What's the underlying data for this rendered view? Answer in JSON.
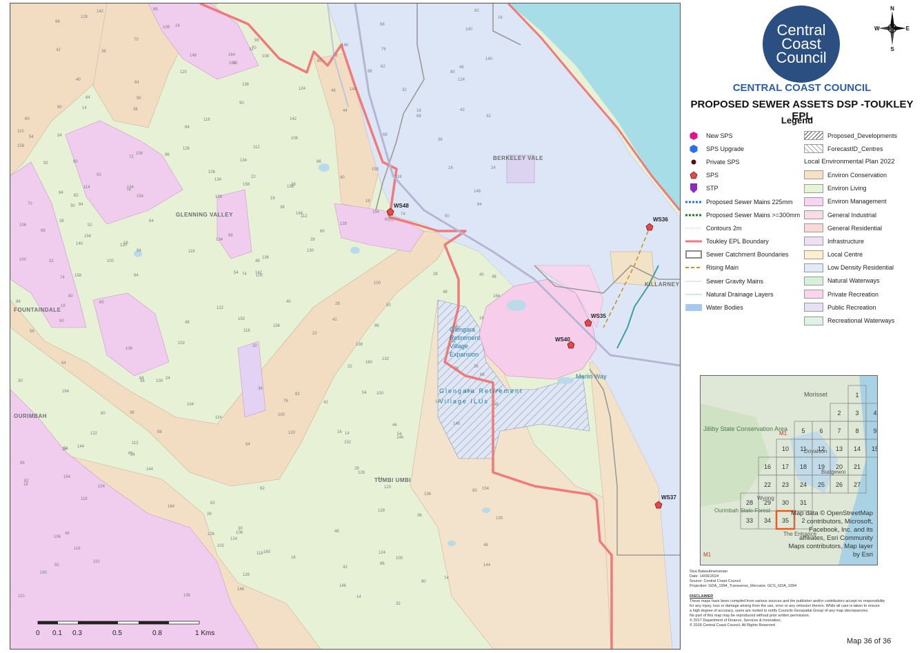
{
  "map": {
    "place_labels": [
      "BERKELEY VALE",
      "GLENNING VALLEY",
      "FOUNTAINDALE",
      "OURIMBAH",
      "TUMBI UMBI",
      "KILLARNEY VALE"
    ],
    "captions": {
      "glengara_expansion": [
        "Glengara",
        "Retirement",
        "Village",
        "Expansion"
      ],
      "glengara_ilus": [
        "Glengara Retirement",
        "Village ILUs"
      ],
      "small_area": "Marlin Way"
    },
    "sps_points": [
      {
        "label": "WS48"
      },
      {
        "label": "WS36"
      },
      {
        "label": "WS35"
      },
      {
        "label": "WS40"
      },
      {
        "label": "WS37"
      }
    ],
    "contour_values": [
      "14",
      "16",
      "18",
      "22",
      "24",
      "26",
      "28",
      "30",
      "32",
      "34",
      "36",
      "38",
      "40",
      "42",
      "44",
      "46",
      "48",
      "50",
      "52",
      "54",
      "56",
      "60",
      "62",
      "64",
      "68",
      "70",
      "72",
      "74",
      "76",
      "80",
      "82",
      "84",
      "86",
      "88",
      "90",
      "92",
      "94",
      "96",
      "98",
      "100",
      "102",
      "104",
      "106",
      "108",
      "110",
      "112",
      "114",
      "116",
      "118",
      "120",
      "122",
      "124",
      "126",
      "128",
      "130",
      "132",
      "134",
      "136",
      "138",
      "140",
      "142",
      "144",
      "146",
      "148",
      "150",
      "152",
      "154",
      "156",
      "158",
      "160",
      "164",
      "166"
    ],
    "scale_bar": {
      "ticks": [
        "0",
        "0.1",
        "0.3",
        "0.5",
        "0.8",
        "1 Kms"
      ]
    },
    "colors": {
      "environ_conservation": "#f3dcc0",
      "environ_living": "#e4f2d2",
      "environ_management": "#f2cdee",
      "low_density_residential": "#dce6f5",
      "private_recreation": "#f7cde8",
      "public_recreation": "#ddd4f0",
      "water": "#a9dce6",
      "epl_boundary": "#f07a7a"
    }
  },
  "sidebar": {
    "logo_lines": [
      "Central",
      "Coast",
      "Council"
    ],
    "compass": {
      "n": "N",
      "s": "S",
      "e": "E",
      "w": "W"
    },
    "org_name": "CENTRAL COAST COUNCIL",
    "map_title": "PROPOSED SEWER ASSETS DSP -TOUKLEY EPL",
    "legend_title": "Legend",
    "legend_left": [
      {
        "label": "New SPS",
        "icon": "hexagon-magenta"
      },
      {
        "label": "SPS Upgrade",
        "icon": "hexagon-blue"
      },
      {
        "label": "Private SPS",
        "icon": "dot-dark-red"
      },
      {
        "label": "SPS",
        "icon": "pentagon-red"
      },
      {
        "label": "STP",
        "icon": "pin-purple"
      },
      {
        "label": "Proposed Sewer Mains 225mm",
        "icon": "dashed-blue"
      },
      {
        "label": "Proposed Sewer Mains >=300mm",
        "icon": "dashed-green"
      },
      {
        "label": "Contours 2m",
        "icon": "dotted-grey"
      },
      {
        "label": "Toukley EPL Boundary",
        "icon": "line-red"
      },
      {
        "label": "Sewer Catchment Boundaries",
        "icon": "box-grey"
      },
      {
        "label": "Rising Main",
        "icon": "dashed-orange"
      },
      {
        "label": "Sewer Gravity Mains",
        "icon": "line-thin-grey"
      },
      {
        "label": "Natural Drainage Layers",
        "icon": "line-thin-blue"
      },
      {
        "label": "Water Bodies",
        "icon": "box-water"
      }
    ],
    "legend_right_top": [
      {
        "label": "Proposed_Developments",
        "icon": "hatch-dense"
      },
      {
        "label": "ForecastID_Centres",
        "icon": "hatch-sparse"
      }
    ],
    "lep_heading": "Local Environmental Plan 2022",
    "lep_zones": [
      {
        "label": "Environ Conservation",
        "color": "#f6e1c6"
      },
      {
        "label": "Environ Living",
        "color": "#e6f4d6"
      },
      {
        "label": "Environ Management",
        "color": "#f6d4f2"
      },
      {
        "label": "General Industrial",
        "color": "#f7dce8"
      },
      {
        "label": "General Residential",
        "color": "#fbd8d8"
      },
      {
        "label": "Infrastructure",
        "color": "#ede0f4"
      },
      {
        "label": "Local Centre",
        "color": "#fbefcf"
      },
      {
        "label": "Low Density Residential",
        "color": "#e1eaf7"
      },
      {
        "label": "Natural Waterways",
        "color": "#d6f0da"
      },
      {
        "label": "Private Recreation",
        "color": "#f9d6ec"
      },
      {
        "label": "Public Recreation",
        "color": "#e6e0f5"
      },
      {
        "label": "Recreational Waterways",
        "color": "#ddf3e3"
      }
    ],
    "inset": {
      "grid_numbers": [
        "1",
        "2",
        "3",
        "4",
        "5",
        "6",
        "7",
        "8",
        "9",
        "10",
        "11",
        "12",
        "13",
        "14",
        "15",
        "16",
        "17",
        "18",
        "19",
        "20",
        "21",
        "22",
        "23",
        "24",
        "25",
        "26",
        "27",
        "28",
        "29",
        "30",
        "31",
        "33",
        "34",
        "35",
        "2"
      ],
      "highlight": "35",
      "place_names": [
        "Morisset",
        "Jilliby State Conservation Area",
        "Doyalson",
        "Budgewoi",
        "Wyong",
        "Ourimbah State Forest",
        "The Entrance",
        "M1",
        "M1"
      ],
      "attribution": "Map data © OpenStreetMap contributors, Microsoft, Facebook, Inc. and its affiliates, Esri Community Maps contributors, Map layer by Esri"
    },
    "meta_lines": [
      "Siva Balasubramanian",
      "Date: 14/06/2024",
      "Source: Central Coast Council",
      "Projection: GDA_1994_Transverse_Mercator; GCS_GDA_1994"
    ],
    "disclaimer_heading": "DISCLAIMER",
    "disclaimer_lines": [
      "These maps have been compiled from various sources and the publisher and/or contributors accept no responsibility",
      "for any injury, loss or damage arising from the use, error or any omission therein. While all care is taken to ensure",
      "a high degree of accuracy, users are invited to notify Councils Geospatial Group of any map discrepancies.",
      "No part of this map may be reproduced without prior written permission.",
      "© 2017 Department of Finance, Services & Innovation,",
      "© 2018 Central Coast Council, All Rights Reserved"
    ],
    "page_number": "Map 36 of 36"
  }
}
